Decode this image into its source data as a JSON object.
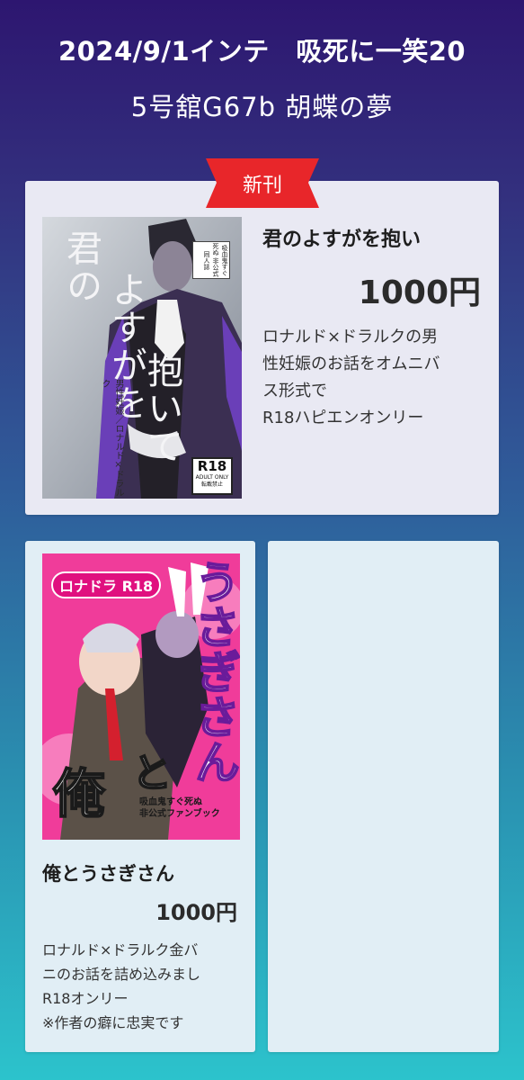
{
  "header": {
    "event_line": "2024/9/1インテ　吸死に一笑20",
    "booth_line": "5号舘G67b 胡蝶の夢"
  },
  "badge": {
    "label": "新刊",
    "color": "#e8262a"
  },
  "books": [
    {
      "title": "君のよすがを抱い",
      "price": "1000円",
      "description": [
        "ロナルド×ドラルクの男",
        "性妊娠のお話をオムニバ",
        "ス形式で",
        "R18ハピエンオンリー"
      ],
      "cover": {
        "title_a": "君の",
        "title_b": "よすがを",
        "title_c": "抱いて",
        "subtitle": "男性妊娠／ロナルド×ドラルク",
        "notice": "吸血鬼すぐ死ぬ 非公式同人誌",
        "rating": "R18",
        "rating_note": "ADULT ONLY",
        "rating_note2": "転載禁止"
      }
    },
    {
      "title": "俺とうさぎさん",
      "price": "1000円",
      "description": [
        "ロナルド×ドラルク金バ",
        "ニのお話を詰め込みまし",
        "R18オンリー",
        "※作者の癖に忠実です"
      ],
      "cover": {
        "tag": "ロナドラ R18",
        "title_vertical": "うさぎさん",
        "title_to": "と",
        "title_ore": "俺",
        "sub_line1": "吸血鬼すぐ死ぬ",
        "sub_line2": "非公式ファンブック"
      }
    }
  ],
  "colors": {
    "bg_top": "#2d1670",
    "bg_bottom": "#2cc3cc",
    "card1": "#e9e9f3",
    "card2": "#e1eef5",
    "cover2_pink": "#f03c9a"
  }
}
